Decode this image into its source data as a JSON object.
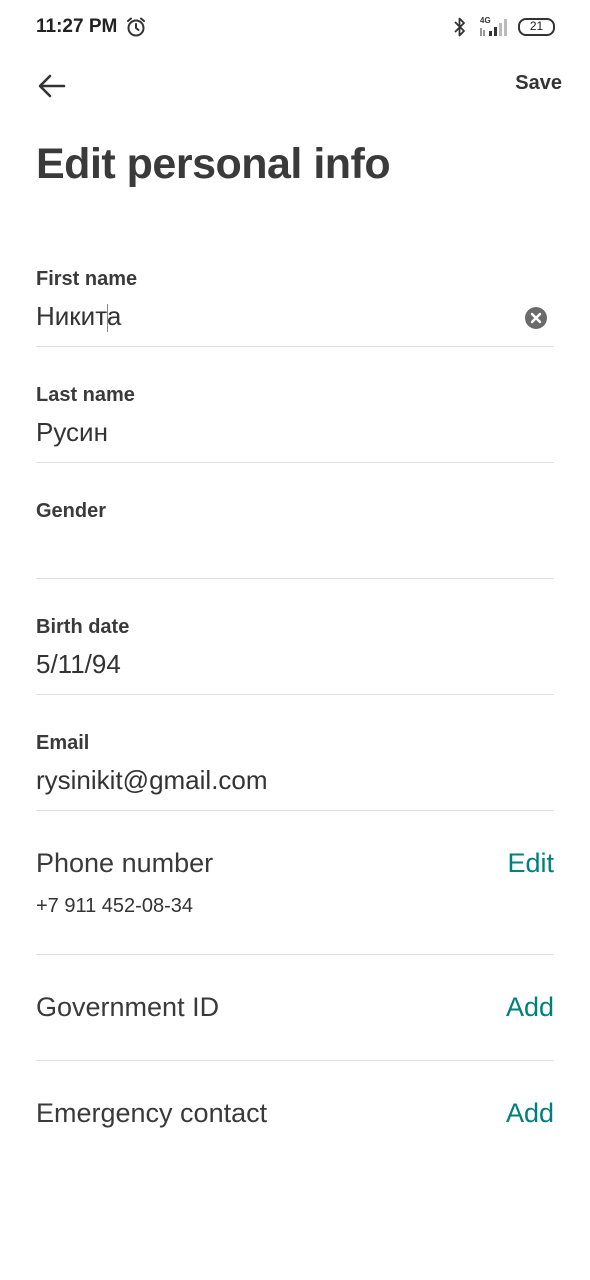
{
  "status_bar": {
    "time": "11:27 PM",
    "network": "4G",
    "battery": "21",
    "icons": [
      "alarm-icon",
      "bluetooth-icon",
      "signal-icon",
      "battery-icon"
    ]
  },
  "header": {
    "back_icon": "arrow-left-icon",
    "save_label": "Save",
    "title": "Edit personal info"
  },
  "fields": {
    "first_name": {
      "label": "First name",
      "value": "Никита"
    },
    "last_name": {
      "label": "Last name",
      "value": "Русин"
    },
    "gender": {
      "label": "Gender",
      "value": ""
    },
    "birth_date": {
      "label": "Birth date",
      "value": "5/11/94"
    },
    "email": {
      "label": "Email",
      "value": "rysinikit@gmail.com"
    }
  },
  "rows": {
    "phone": {
      "title": "Phone number",
      "action": "Edit",
      "value": "+7 911 452-08-34"
    },
    "government_id": {
      "title": "Government ID",
      "action": "Add"
    },
    "emergency_contact": {
      "title": "Emergency contact",
      "action": "Add"
    }
  },
  "colors": {
    "accent": "#00807a",
    "text": "#3a3a3a",
    "divider": "#e2e2e2"
  }
}
